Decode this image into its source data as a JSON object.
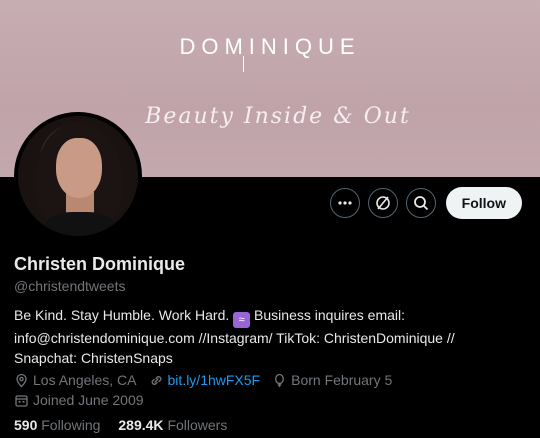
{
  "banner": {
    "brand": "DOMINIQUE",
    "tagline": "Beauty Inside & Out",
    "bg_color": "#c4a9af"
  },
  "profile": {
    "name": "Christen Dominique",
    "handle": "@christendtweets",
    "bio_line1": "Be Kind. Stay Humble. Work Hard.",
    "bio_line1_after": " Business inquires email:",
    "bio_line2": "info@christendominique.com //Instagram/ TikTok: ChristenDominique //",
    "bio_line3": "Snapchat: ChristenSnaps",
    "zodiac_icon": "aquarius-icon",
    "location": "Los Angeles, CA",
    "link": "bit.ly/1hwFX5F",
    "born": "Born February 5",
    "joined": "Joined June 2009"
  },
  "stats": {
    "following_count": "590",
    "following_label": "Following",
    "followers_count": "289.4K",
    "followers_label": "Followers"
  },
  "actions": {
    "follow_label": "Follow",
    "more_icon": "more-icon",
    "subscribe_icon": "no-subscribe-icon",
    "search_icon": "search-icon"
  },
  "colors": {
    "link": "#1d9bf0",
    "muted": "#71767b",
    "text": "#e7e9ea"
  }
}
